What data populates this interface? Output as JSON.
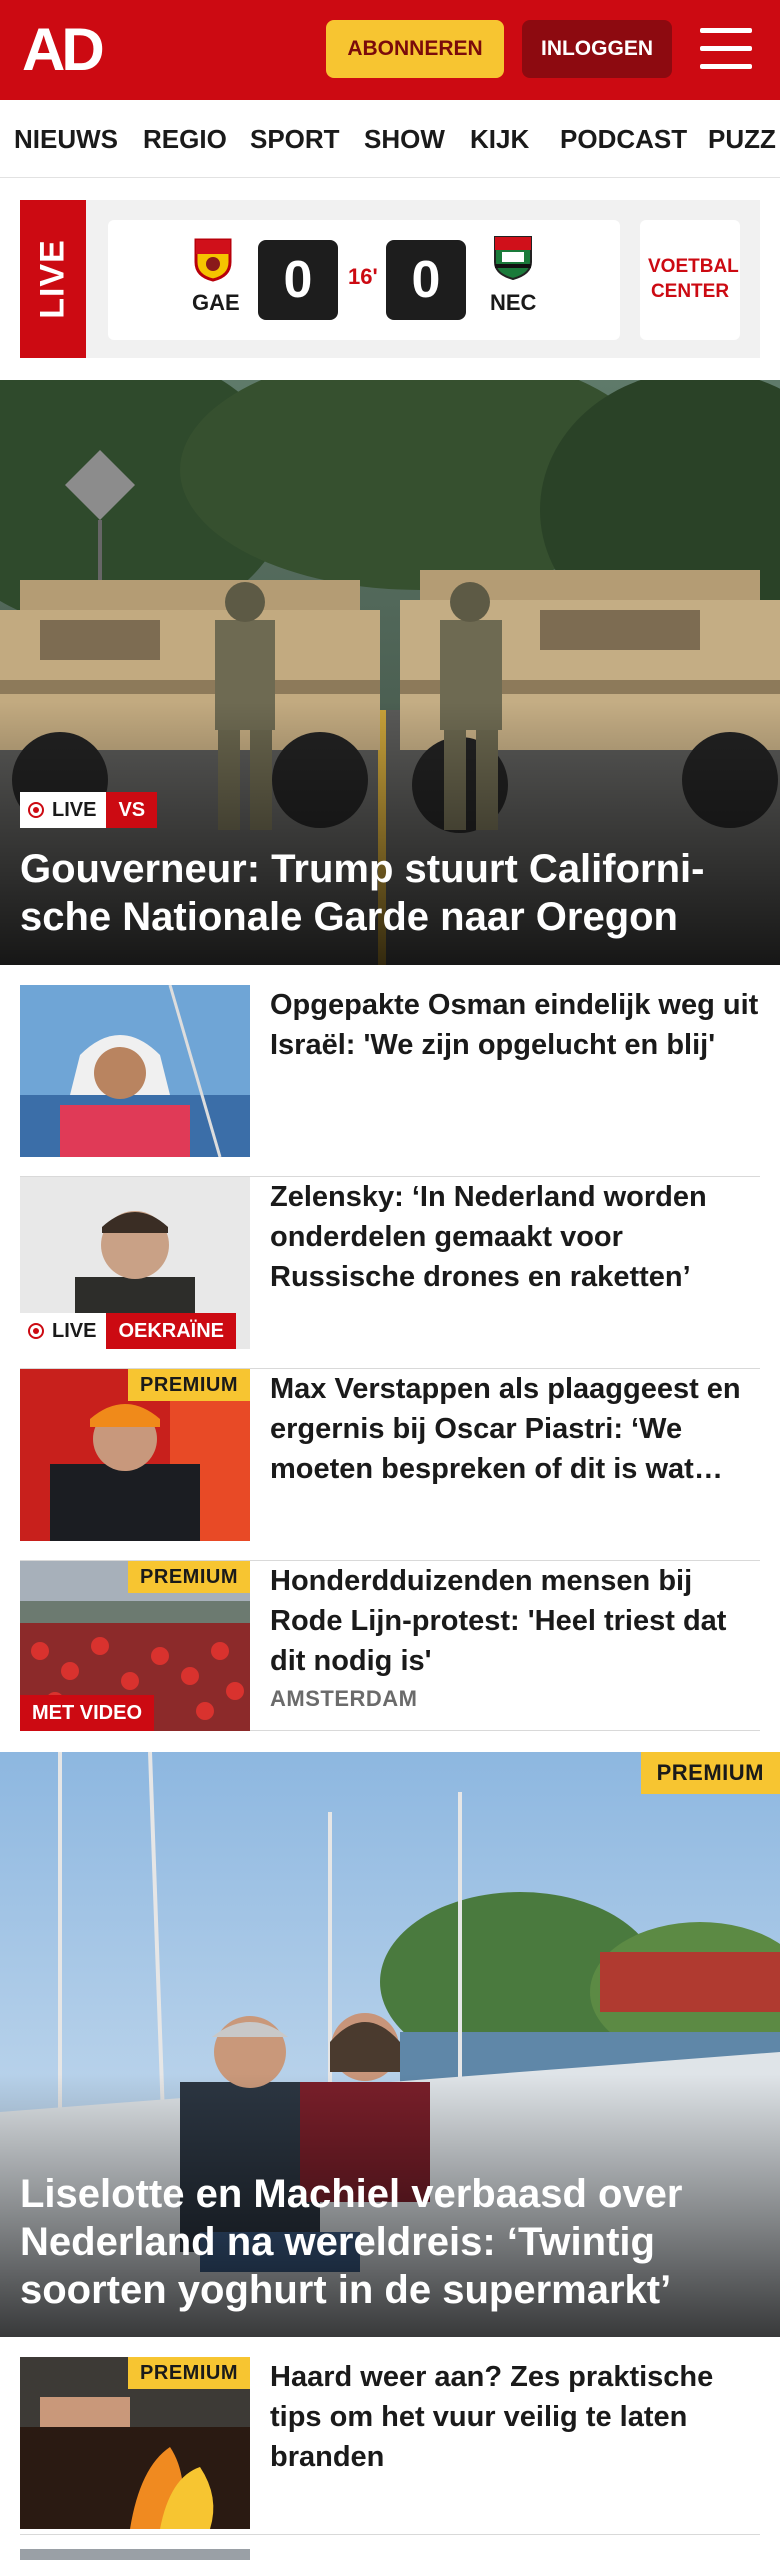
{
  "header": {
    "logo": "AD",
    "subscribe_label": "ABONNEREN",
    "login_label": "INLOGGEN",
    "menu_icon": "hamburger-menu-icon",
    "colors": {
      "brand_red": "#cc0a12",
      "subscribe_yellow": "#f7c531",
      "login_dark_red": "#8d0a10"
    }
  },
  "nav": {
    "items": [
      "NIEUWS",
      "REGIO",
      "SPORT",
      "SHOW",
      "KIJK",
      "PODCAST",
      "PUZZ"
    ]
  },
  "live_widget": {
    "tab_label": "LIVE",
    "home_team": "GAE",
    "home_score": "0",
    "minute": "16'",
    "away_score": "0",
    "away_team": "NEC",
    "home_crest_icon": "go-ahead-eagles-crest-icon",
    "away_crest_icon": "nec-crest-icon",
    "voetbal_center_label": "VOETBAL CENTER"
  },
  "hero": {
    "live_label": "LIVE",
    "tag": "VS",
    "title": "Gouverneur: Trump stuurt Californi­sche Nationale Garde naar Oregon"
  },
  "articles": [
    {
      "title": "Opgepakte Osman eindelijk weg uit Israël: 'We zijn opgelucht en blij'"
    },
    {
      "title": "Zelensky: ‘In Nederland worden onderdelen gemaakt voor Russische drones en raketten’",
      "live_label": "LIVE",
      "tag": "OEKRAÏNE"
    },
    {
      "title": "Max Verstappen als plaaggeest en ergernis bij Oscar Piastri: ‘We moeten bespreken of dit is wat…",
      "premium_label": "PREMIUM"
    },
    {
      "title": "Honderdduizenden mensen bij Rode Lijn-protest: 'Heel triest dat dit nodig is'",
      "premium_label": "PREMIUM",
      "video_label": "MET VIDEO",
      "meta": "AMSTERDAM"
    }
  ],
  "feature": {
    "premium_label": "PREMIUM",
    "title": "Liselotte en Machiel verbaasd over Nederland na wereldreis: ‘Twintig soorten yoghurt in de supermarkt’"
  },
  "articles_after": [
    {
      "title": "Haard weer aan? Zes praktische tips om het vuur veilig te laten branden",
      "premium_label": "PREMIUM"
    }
  ]
}
